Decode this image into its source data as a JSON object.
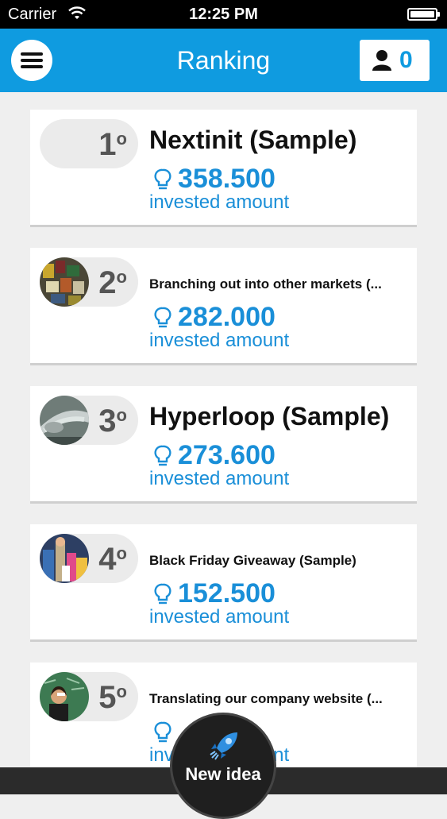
{
  "status_bar": {
    "carrier": "Carrier",
    "time": "12:25 PM"
  },
  "header": {
    "title": "Ranking",
    "user_count": "0"
  },
  "ranking": [
    {
      "rank": "1",
      "suffix": "o",
      "title": "Nextinit (Sample)",
      "amount": "358.500",
      "label": "invested amount",
      "has_image": false
    },
    {
      "rank": "2",
      "suffix": "o",
      "title": "Branching out into other markets (...",
      "amount": "282.000",
      "label": "invested amount",
      "has_image": true
    },
    {
      "rank": "3",
      "suffix": "o",
      "title": "Hyperloop (Sample)",
      "amount": "273.600",
      "label": "invested amount",
      "has_image": true
    },
    {
      "rank": "4",
      "suffix": "o",
      "title": "Black Friday Giveaway (Sample)",
      "amount": "152.500",
      "label": "invested amount",
      "has_image": true
    },
    {
      "rank": "5",
      "suffix": "o",
      "title": "Translating our company website (...",
      "amount": "",
      "label": "invested amount",
      "has_image": true
    }
  ],
  "fab": {
    "label": "New idea"
  },
  "colors": {
    "accent": "#0f9be0",
    "amount": "#1a8fd8"
  }
}
